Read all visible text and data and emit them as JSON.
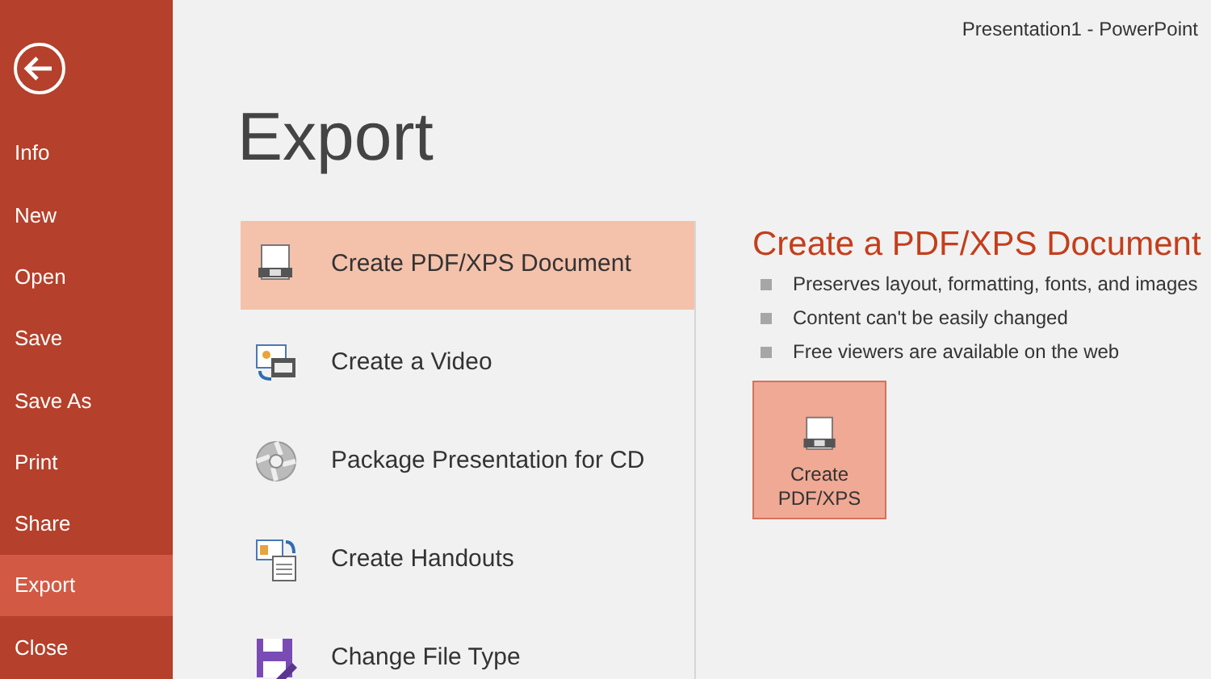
{
  "window": {
    "title": "Presentation1 - PowerPoint"
  },
  "sidebar": {
    "items": [
      {
        "label": "Info",
        "selected": false
      },
      {
        "label": "New",
        "selected": false
      },
      {
        "label": "Open",
        "selected": false
      },
      {
        "label": "Save",
        "selected": false
      },
      {
        "label": "Save As",
        "selected": false
      },
      {
        "label": "Print",
        "selected": false
      },
      {
        "label": "Share",
        "selected": false
      },
      {
        "label": "Export",
        "selected": true
      },
      {
        "label": "Close",
        "selected": false
      }
    ]
  },
  "heading": "Export",
  "options": [
    {
      "kind": "pdf",
      "label": "Create PDF/XPS Document",
      "selected": true
    },
    {
      "kind": "video",
      "label": "Create a Video",
      "selected": false
    },
    {
      "kind": "cd",
      "label": "Package Presentation for CD",
      "selected": false
    },
    {
      "kind": "handouts",
      "label": "Create Handouts",
      "selected": false
    },
    {
      "kind": "filetype",
      "label": "Change File Type",
      "selected": false
    }
  ],
  "detail": {
    "title": "Create a PDF/XPS Document",
    "bullets": [
      "Preserves layout, formatting, fonts, and images",
      "Content can't be easily changed",
      "Free viewers are available on the web"
    ],
    "button": {
      "label_lines": [
        "Create",
        "PDF/XPS"
      ]
    }
  }
}
